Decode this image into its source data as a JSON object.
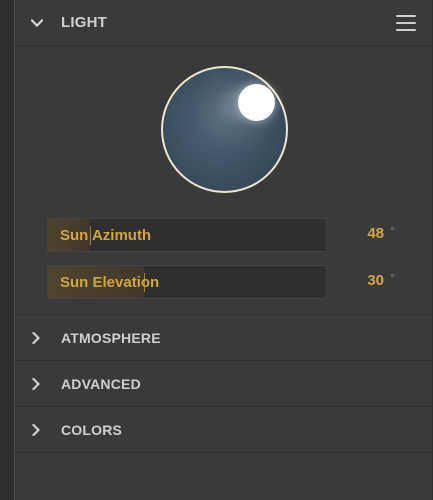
{
  "light": {
    "title": "LIGHT",
    "menu_icon": "hamburger-menu-icon",
    "sun_dial": {
      "azimuth_value": 48,
      "elevation_value": 30
    },
    "params": [
      {
        "label": "Sun Azimuth",
        "value": "48",
        "unit": "°"
      },
      {
        "label": "Sun Elevation",
        "value": "30",
        "unit": "°"
      }
    ]
  },
  "sections": [
    {
      "label": "ATMOSPHERE",
      "icon": "chevron-right-icon"
    },
    {
      "label": "ADVANCED",
      "icon": "chevron-right-icon"
    },
    {
      "label": "COLORS",
      "icon": "chevron-right-icon"
    }
  ],
  "colors": {
    "panel_bg": "#3a3a3a",
    "accent": "#d2a540",
    "dial_border": "#efe6cf"
  }
}
